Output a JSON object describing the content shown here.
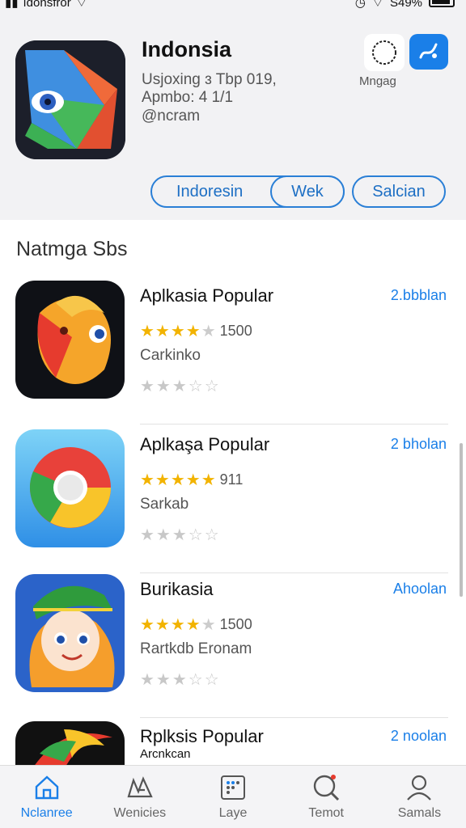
{
  "status_bar": {
    "carrier": "ıdonsfror",
    "battery_text": "S49%"
  },
  "header": {
    "app_title": "Indonsia",
    "sub_line1": "Usjoxing ɜ Tbp 019,",
    "sub_line2": "Apmbo:  4 1/1",
    "sub_line3": "@ncram",
    "manage_label": "Mngag",
    "pills": [
      "Indoresin",
      "Wek",
      "Salcian"
    ]
  },
  "section": {
    "title": "Natmga Sbs"
  },
  "apps": [
    {
      "title": "Aplkasia Popular",
      "rating_count": "1500",
      "developer": "Carkinko",
      "get_label": "2.bbblan"
    },
    {
      "title": "Aplkaşa Popular",
      "rating_count": "911",
      "developer": "Sarkab",
      "get_label": "2 bholan"
    },
    {
      "title": "Burikasia",
      "rating_count": "1500",
      "developer": "Rartkdb Eronam",
      "get_label": "Ahoolan"
    },
    {
      "title": "Rplksis Popular",
      "subtitle": "Arcnkcan",
      "get_label": "2 noolan"
    }
  ],
  "tabs": [
    {
      "label": "Nclanree",
      "icon": "home-icon",
      "active": true
    },
    {
      "label": "Wenicies",
      "icon": "games-icon",
      "active": false
    },
    {
      "label": "Laye",
      "icon": "apps-icon",
      "active": false
    },
    {
      "label": "Temot",
      "icon": "search-icon",
      "active": false
    },
    {
      "label": "Samals",
      "icon": "person-icon",
      "active": false
    }
  ],
  "colors": {
    "accent": "#1a7fe8",
    "star": "#f2b300",
    "header_bg": "#f2f2f4"
  }
}
